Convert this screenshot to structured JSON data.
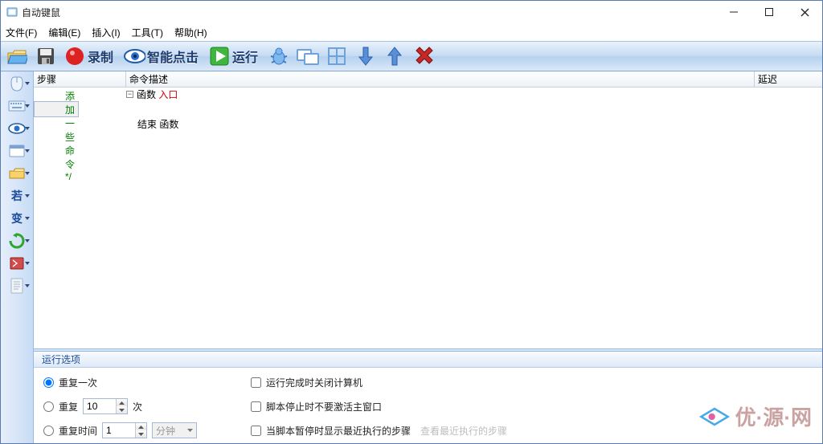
{
  "title": "自动键鼠",
  "menu": [
    "文件(F)",
    "编辑(E)",
    "插入(I)",
    "工具(T)",
    "帮助(H)"
  ],
  "toolbar": {
    "record": "录制",
    "smartclick": "智能点击",
    "run": "运行"
  },
  "leftbar": {
    "if": "若",
    "var": "变"
  },
  "columns": [
    "步骤",
    "命令描述",
    "延迟"
  ],
  "rows": [
    {
      "a": "函数",
      "b": "入口"
    },
    {
      "a": "/* 在这里添加一些命令 */"
    },
    {
      "a": "结束 函数"
    }
  ],
  "panel": {
    "title": "运行选项",
    "repeat_once": "重复一次",
    "repeat": "重复",
    "repeat_n": "10",
    "times": "次",
    "repeat_time": "重复时间",
    "repeat_time_n": "1",
    "unit": "分钟",
    "chk1": "运行完成时关闭计算机",
    "chk2": "脚本停止时不要激活主窗口",
    "chk3": "当脚本暂停时显示最近执行的步骤",
    "hint": "查看最近执行的步骤"
  },
  "watermark": "优·源·网"
}
